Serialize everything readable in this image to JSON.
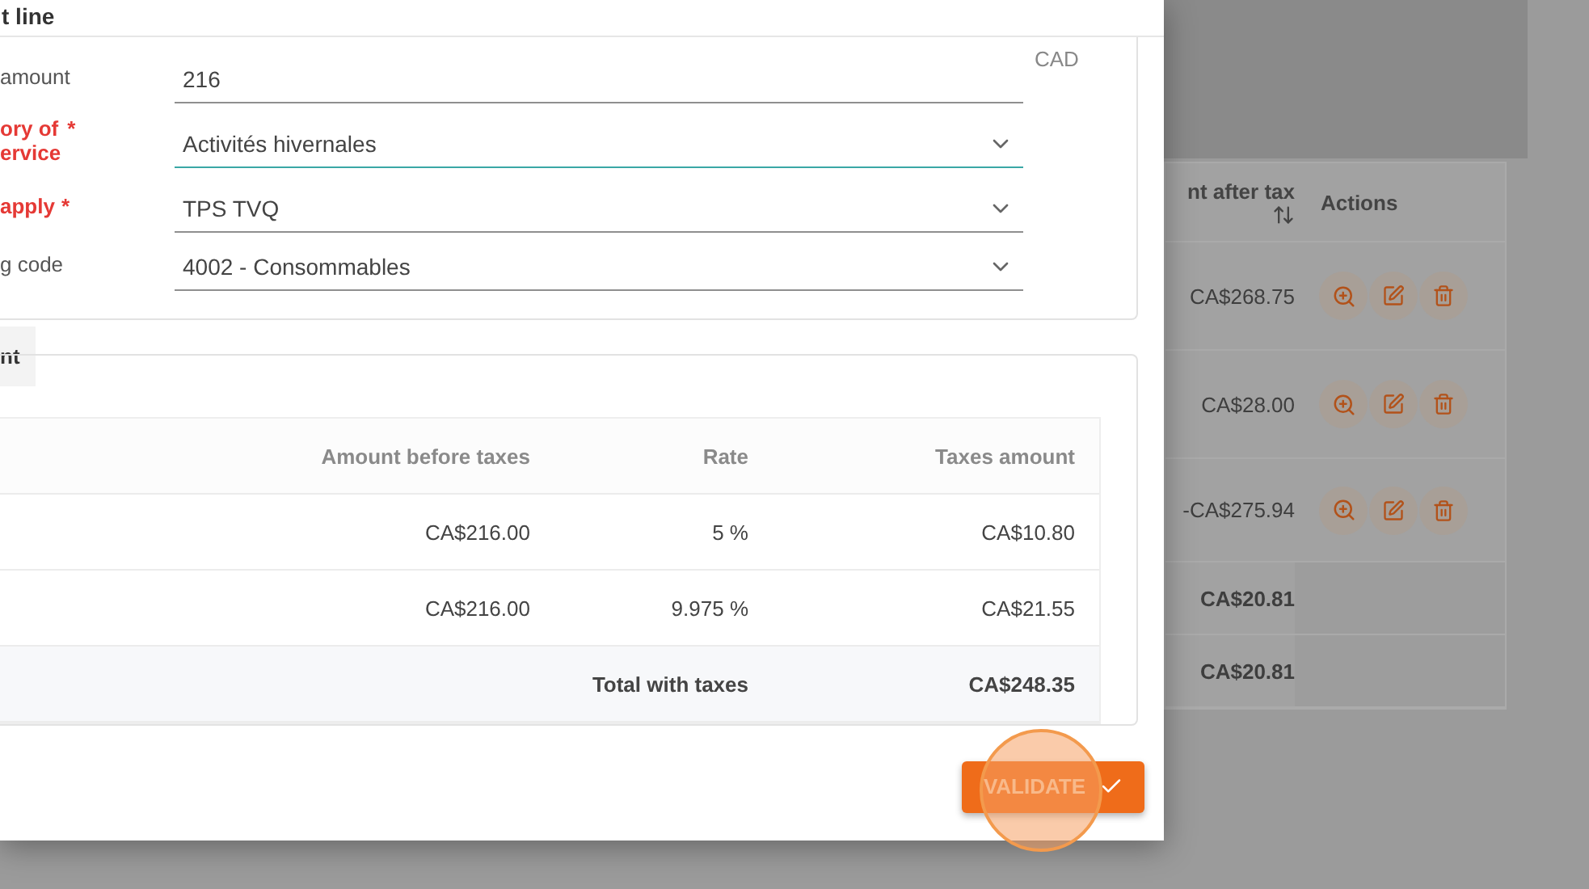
{
  "dialog": {
    "title": "t line",
    "fields": [
      {
        "label": "amount",
        "kind": "text",
        "value": "216",
        "suffix": "CAD",
        "focused": false
      },
      {
        "label": "ory of\nervice",
        "required_mark": "*",
        "kind": "select",
        "value": "Activités hivernales",
        "focused": true
      },
      {
        "label": "apply",
        "required_mark": "*",
        "kind": "select",
        "value": "TPS TVQ",
        "focused": false
      },
      {
        "label": "g code",
        "kind": "select",
        "value": "4002 - Consommables",
        "focused": false
      }
    ],
    "tab": "nt",
    "tax_table": {
      "columns": [
        "Amount before taxes",
        "Rate",
        "Taxes amount"
      ],
      "rows": [
        {
          "amount": "CA$216.00",
          "rate": "5 %",
          "taxes": "CA$10.80"
        },
        {
          "amount": "CA$216.00",
          "rate": "9.975 %",
          "taxes": "CA$21.55"
        }
      ],
      "total": {
        "label": "Total with taxes",
        "value": "CA$248.35"
      }
    },
    "validate_button": "VALIDATE"
  },
  "background_table": {
    "columns": [
      "nt after tax",
      "Actions"
    ],
    "rows": [
      {
        "amount": "CA$268.75"
      },
      {
        "amount": "CA$28.00"
      },
      {
        "amount": "-CA$275.94"
      }
    ],
    "totals": [
      "CA$20.81",
      "CA$20.81"
    ]
  }
}
